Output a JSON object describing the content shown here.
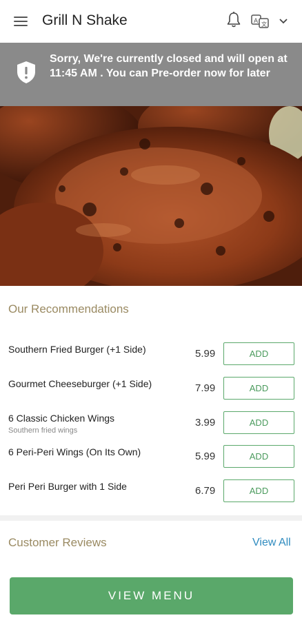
{
  "header": {
    "title": "Grill N Shake",
    "icons": {
      "menu": "hamburger-menu-icon",
      "notifications": "bell-icon",
      "language": "translate-icon",
      "dropdown": "chevron-down-icon"
    }
  },
  "banner": {
    "icon": "shield-alert-icon",
    "text": "Sorry, We're currently closed and will open at 11:45 AM . You can Pre-order now for later"
  },
  "recommendations": {
    "title": "Our Recommendations",
    "items": [
      {
        "name": "Southern Fried Burger (+1 Side)",
        "subtitle": "",
        "price": "5.99",
        "action": "ADD"
      },
      {
        "name": "Gourmet Cheeseburger (+1 Side)",
        "subtitle": "",
        "price": "7.99",
        "action": "ADD"
      },
      {
        "name": "6 Classic Chicken Wings",
        "subtitle": "Southern fried wings",
        "price": "3.99",
        "action": "ADD"
      },
      {
        "name": " 6 Peri-Peri Wings (On Its Own)",
        "subtitle": "",
        "price": "5.99",
        "action": "ADD"
      },
      {
        "name": "Peri Peri Burger with 1 Side",
        "subtitle": "",
        "price": "6.79",
        "action": "ADD"
      }
    ]
  },
  "reviews": {
    "title": "Customer Reviews",
    "view_all": "View All"
  },
  "footer": {
    "view_menu": "VIEW MENU"
  },
  "colors": {
    "accent": "#5aa86a",
    "banner": "#8a8a8a",
    "section_title": "#9a8a62",
    "link": "#2f8bbf"
  }
}
